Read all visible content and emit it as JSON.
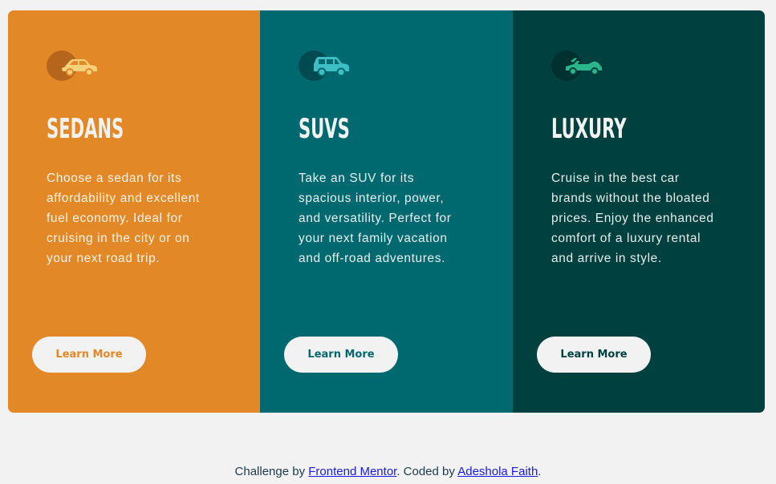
{
  "cards": [
    {
      "id": "sedans",
      "icon": "sedan-car-icon",
      "title": "Sedans",
      "text": "Choose a sedan for its affordability and excellent fuel economy. Ideal for cruising in the city or on your next road trip.",
      "button": "Learn More",
      "colors": {
        "background": "#e38826",
        "icon": "#f7d27a",
        "icon_circle": "#b5651c"
      }
    },
    {
      "id": "suvs",
      "icon": "suv-car-icon",
      "title": "SUVs",
      "text": "Take an SUV for its spacious interior, power, and versatility. Perfect for your next family vacation and off-road adventures.",
      "button": "Learn More",
      "colors": {
        "background": "#006970",
        "icon": "#3dbfc4",
        "icon_circle": "#004b52"
      }
    },
    {
      "id": "luxury",
      "icon": "convertible-car-icon",
      "title": "Luxury",
      "text": "Cruise in the best car brands without the bloated prices. Enjoy the enhanced comfort of a luxury rental and arrive in style.",
      "button": "Learn More",
      "colors": {
        "background": "#004140",
        "icon": "#2ab58a",
        "icon_circle": "#00302f"
      }
    }
  ],
  "attribution": {
    "prefix": "Challenge by ",
    "link1": "Frontend Mentor",
    "middle": ". Coded by ",
    "link2": "Adeshola Faith",
    "suffix": "."
  }
}
